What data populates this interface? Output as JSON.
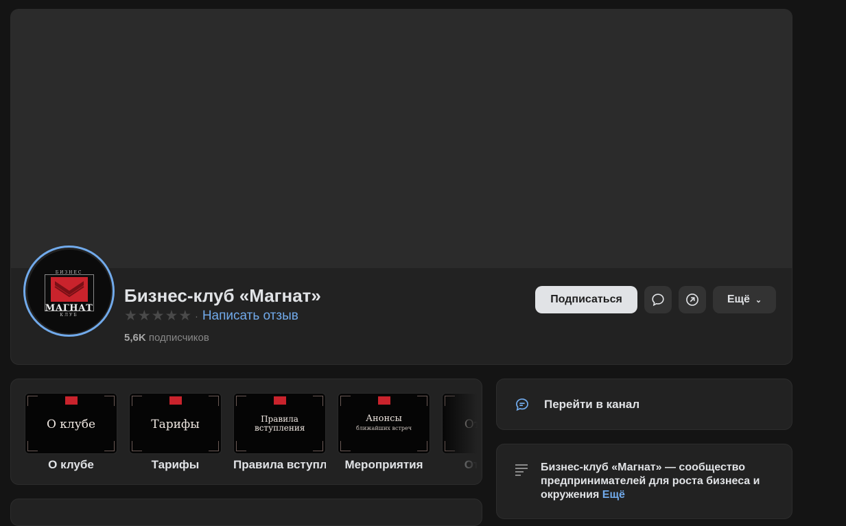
{
  "community": {
    "name": "Бизнес-клуб «Магнат»",
    "write_review": "Написать отзыв",
    "rating_separator": "·",
    "subscribers_count": "5,6K",
    "subscribers_label": "подписчиков"
  },
  "avatar": {
    "top_text": "БИЗНЕС",
    "main_text": "МАГНАТ",
    "bottom_text": "КЛУБ"
  },
  "actions": {
    "subscribe": "Подписаться",
    "more": "Ещё",
    "message_icon": "message-bubble-icon",
    "share_icon": "share-arrow-icon"
  },
  "tabs": [
    {
      "label": "О клубе",
      "cover_title": "О клубе",
      "cover_sub": ""
    },
    {
      "label": "Тарифы",
      "cover_title": "Тарифы",
      "cover_sub": ""
    },
    {
      "label": "Правила вступления",
      "cover_title": "Правила вступления",
      "cover_sub": ""
    },
    {
      "label": "Мероприятия",
      "cover_title": "Анонсы",
      "cover_sub": "ближайших встреч"
    },
    {
      "label": "Отзывы",
      "cover_title": "Отзывы",
      "cover_sub": ""
    }
  ],
  "channel": {
    "label": "Перейти в канал",
    "icon": "chat-channel-icon"
  },
  "about": {
    "text": "Бизнес-клуб «Магнат» — сообщество предпринимателей для роста бизнеса и окружения",
    "more": "Ещё",
    "icon": "text-lines-icon"
  },
  "colors": {
    "accent": "#71aaeb",
    "brand_red": "#c9232c",
    "background": "#141414",
    "card": "#222222"
  }
}
